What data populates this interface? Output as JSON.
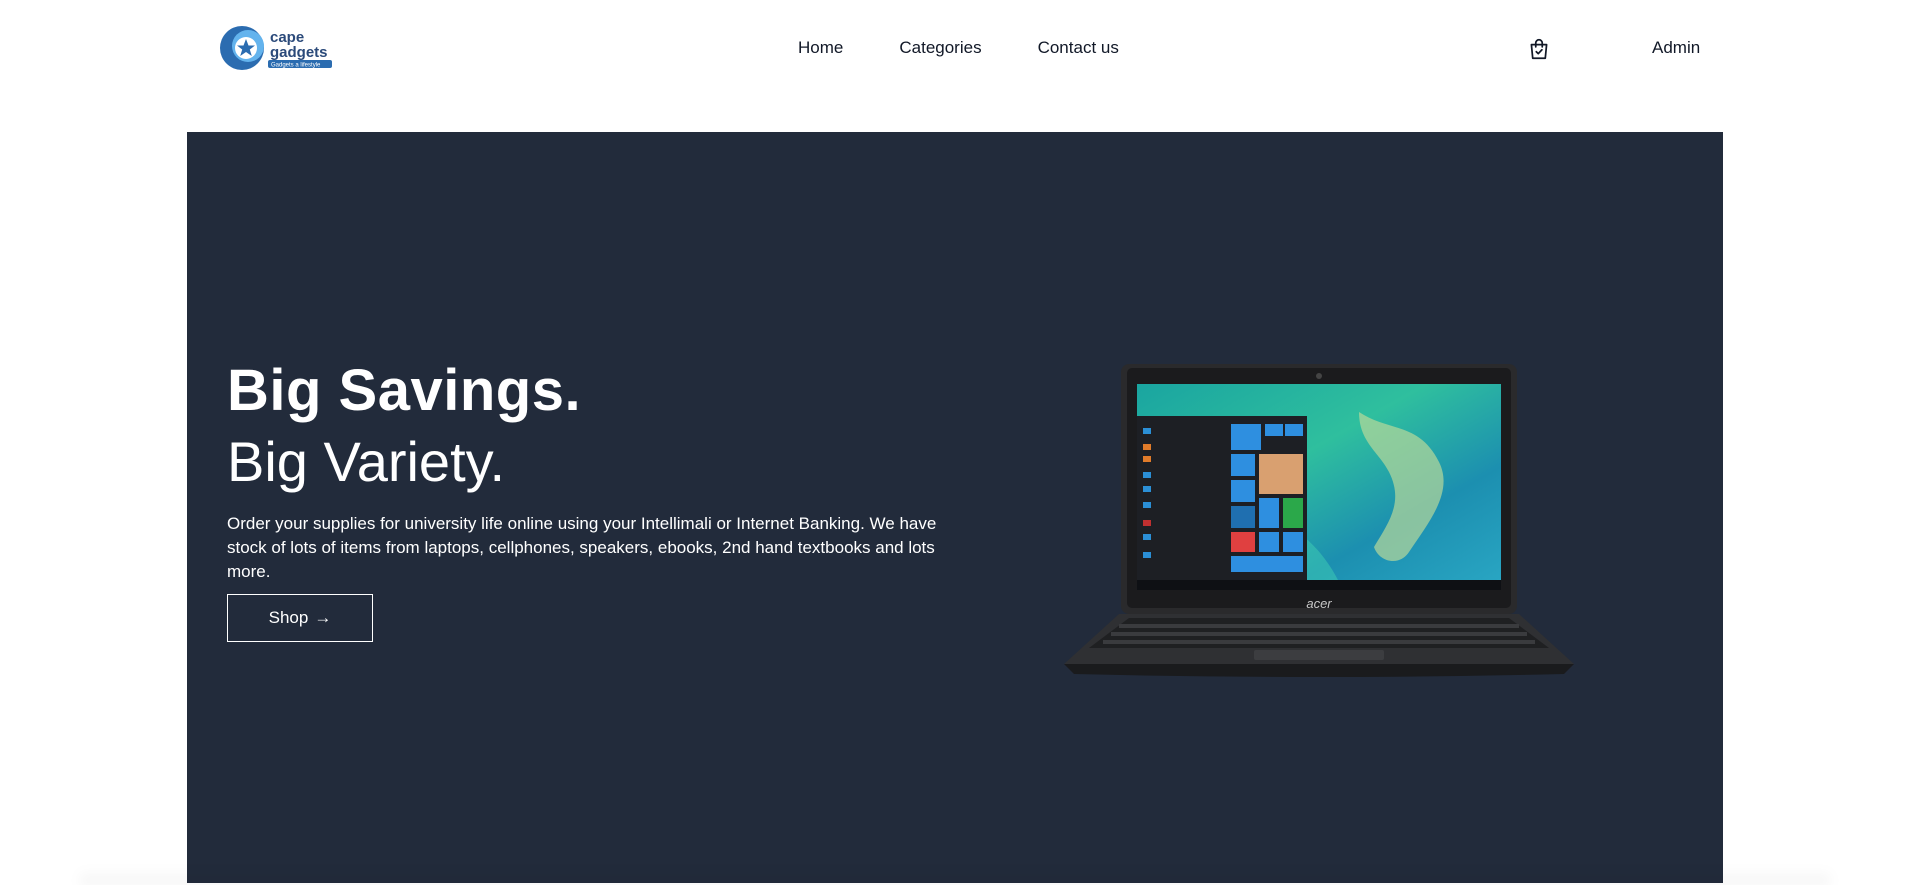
{
  "brand": {
    "logo_line1": "cape",
    "logo_line2": "gadgets",
    "logo_tagline": "Gadgets a lifestyle",
    "colors": {
      "logo_blue": "#2b6cb0",
      "logo_light": "#63b3ed"
    }
  },
  "nav": {
    "items": [
      {
        "label": "Home"
      },
      {
        "label": "Categories"
      },
      {
        "label": "Contact us"
      }
    ],
    "cart_icon": "shopping-bag-icon",
    "admin_label": "Admin"
  },
  "hero": {
    "title": "Big Savings.",
    "subtitle": "Big Variety.",
    "description": "Order your supplies for university life online using your Intellimali or Internet Banking. We have stock of lots of items from laptops, cellphones, speakers, ebooks, 2nd hand textbooks and lots more.",
    "shop_label": "Shop",
    "shop_icon": "arrow-right-icon",
    "image_brand": "acer",
    "background_color": "#222b3b"
  }
}
